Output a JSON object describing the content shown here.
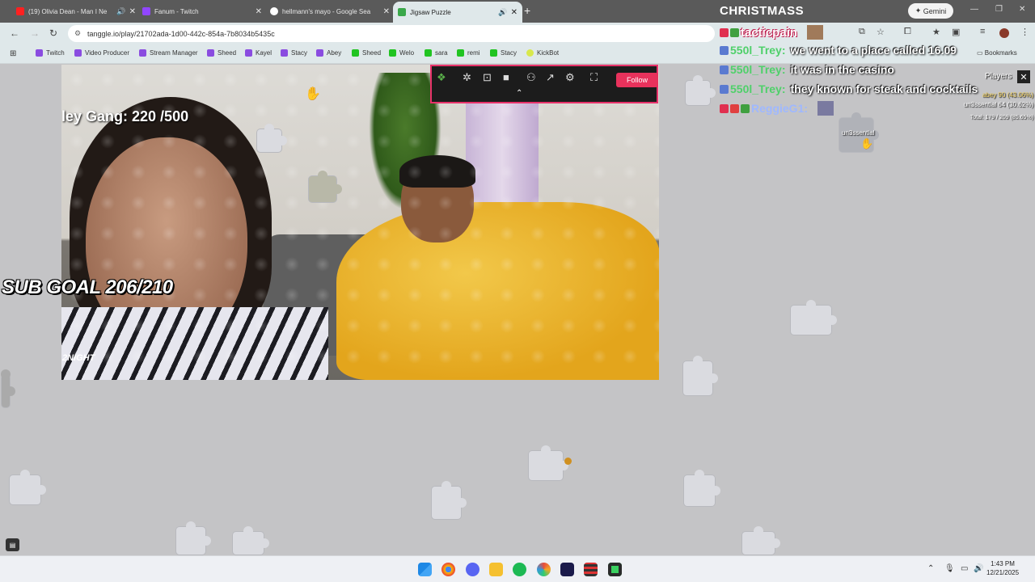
{
  "browser": {
    "tabs": [
      {
        "title": "(19) Olivia Dean - Man I Ne",
        "favicon_color": "#ff2020",
        "audio": true
      },
      {
        "title": "Fanum - Twitch",
        "favicon_color": "#9146ff",
        "audio": false
      },
      {
        "title": "hellmann's mayo - Google Sea",
        "favicon_color": "#ffffff",
        "audio": false
      },
      {
        "title": "Jigsaw Puzzle",
        "favicon_color": "#3aa84a",
        "audio": true,
        "active": true
      }
    ],
    "window_title": "CHRISTMASS",
    "gemini_label": "Gemini",
    "url": "tanggle.io/play/21702ada-1d00-442c-854a-7b8034b5435c",
    "bookmarks": [
      {
        "label": "Twitch",
        "icon": "twitch"
      },
      {
        "label": "Video Producer",
        "icon": "twitch"
      },
      {
        "label": "Stream Manager",
        "icon": "twitch"
      },
      {
        "label": "Sheed",
        "icon": "twitch"
      },
      {
        "label": "Kayel",
        "icon": "twitch"
      },
      {
        "label": "Stacy",
        "icon": "twitch"
      },
      {
        "label": "Abey",
        "icon": "twitch"
      },
      {
        "label": "Sheed",
        "icon": "kick"
      },
      {
        "label": "Welo",
        "icon": "kick"
      },
      {
        "label": "sara",
        "icon": "kick"
      },
      {
        "label": "remi",
        "icon": "kick"
      },
      {
        "label": "Stacy",
        "icon": "kick"
      },
      {
        "label": "KickBot",
        "icon": "kickbot"
      }
    ],
    "bookmarks_folder": "Bookmarks"
  },
  "overlay": {
    "gang_counter": "ley Gang: 220  /500",
    "sub_goal": "SUB GOAL 206/210",
    "logo_text": "2NIGHT",
    "follow_label": "Follow"
  },
  "chat": {
    "top_user": "tacticpain",
    "messages": [
      {
        "user": "550l_Trey:",
        "color": "#4fd06a",
        "text": "we went to a place called 16.09"
      },
      {
        "user": "550l_Trey:",
        "color": "#4fd06a",
        "text": "it was in the casino"
      },
      {
        "user": "550l_Trey:",
        "color": "#4fd06a",
        "text": "they known for steak and cocktails"
      },
      {
        "user": "ReggieG1:",
        "color": "#9fb8ff",
        "text": ""
      }
    ]
  },
  "players": {
    "title": "Players",
    "rows": [
      "abey     90 (43.06%)",
      "un3ssential  64 (30.62%)",
      "Total: 179 / 209 (85.65%)"
    ],
    "cursor_tag": "un3ssential"
  },
  "taskbar": {
    "time": "1:43 PM",
    "date": "12/21/2025"
  }
}
